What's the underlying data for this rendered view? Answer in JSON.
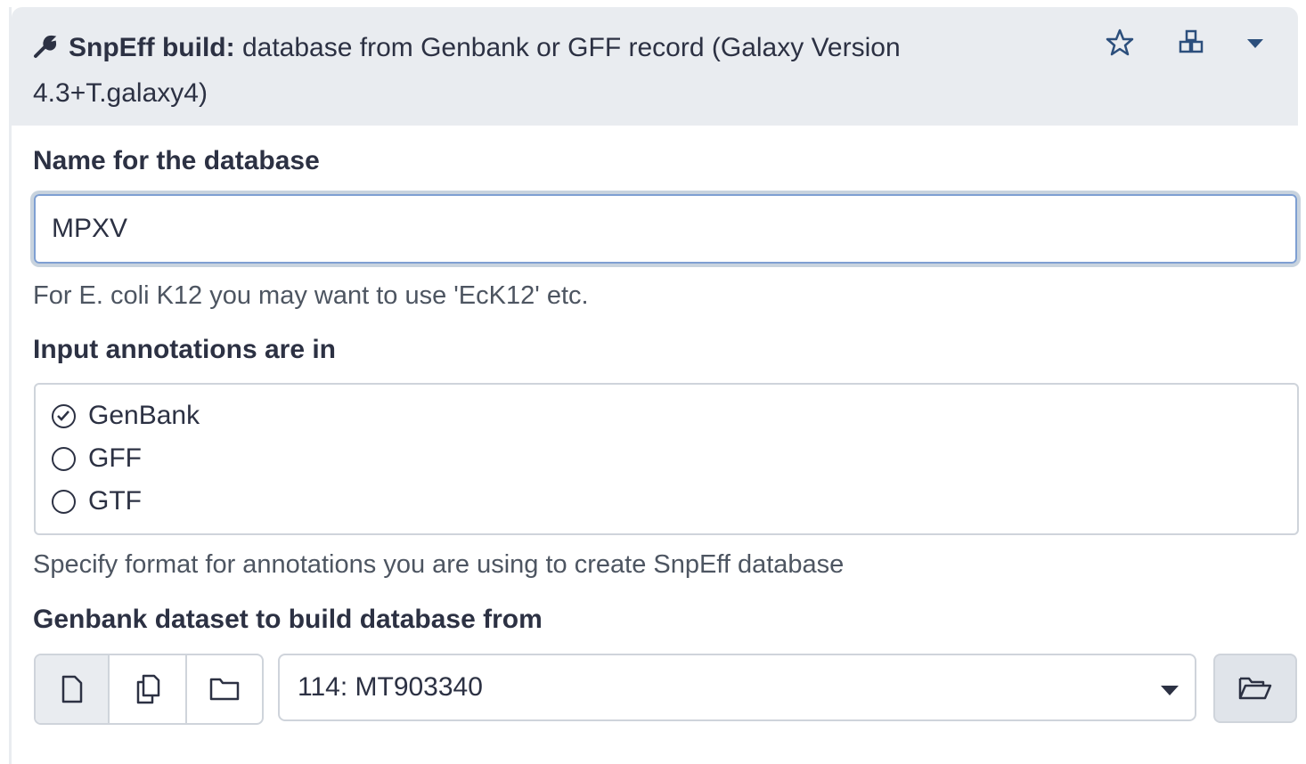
{
  "header": {
    "tool_name": "SnpEff build:",
    "description": "database from Genbank or GFF record (Galaxy Version 4.3+T.galaxy4)"
  },
  "fields": {
    "db_name": {
      "label": "Name for the database",
      "value": "MPXV",
      "help": "For E. coli K12 you may want to use 'EcK12' etc."
    },
    "input_type": {
      "label": "Input annotations are in",
      "options": [
        "GenBank",
        "GFF",
        "GTF"
      ],
      "selected": "GenBank",
      "help": "Specify format for annotations you are using to create SnpEff database"
    },
    "genbank_dataset": {
      "label": "Genbank dataset to build database from",
      "value": "114: MT903340"
    }
  },
  "colors": {
    "header_bg": "#e9ecf0",
    "text": "#2c3143",
    "focus": "#7e9fd2"
  }
}
